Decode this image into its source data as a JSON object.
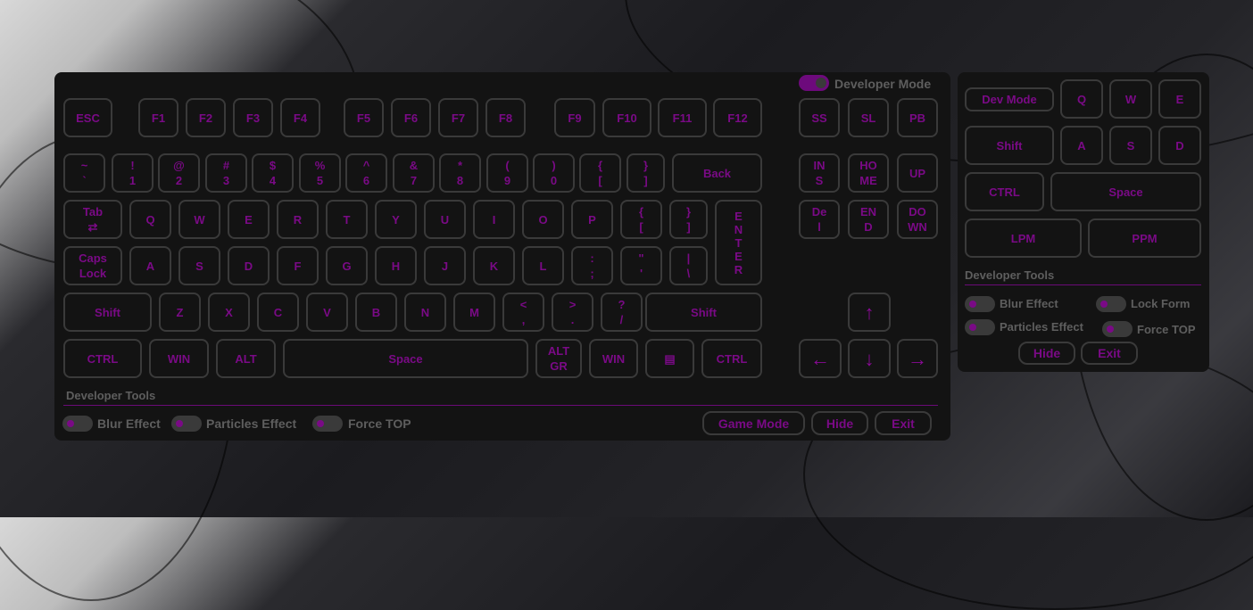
{
  "main": {
    "dev_mode_label": "Developer Mode",
    "keys": {
      "esc": "ESC",
      "f1": "F1",
      "f2": "F2",
      "f3": "F3",
      "f4": "F4",
      "f5": "F5",
      "f6": "F6",
      "f7": "F7",
      "f8": "F8",
      "f9": "F9",
      "f10": "F10",
      "f11": "F11",
      "f12": "F12",
      "ss": "SS",
      "sl": "SL",
      "pb": "PB",
      "tilde": "~\n`",
      "n1": "!\n1",
      "n2": "@\n2",
      "n3": "#\n3",
      "n4": "$\n4",
      "n5": "%\n5",
      "n6": "^\n6",
      "n7": "&\n7",
      "n8": "*\n8",
      "n9": "(\n9",
      "n0": ")\n0",
      "lbrace": "{\n[",
      "rbrace": "}\n]",
      "back": "Back",
      "ins": "IN\nS",
      "home": "HO\nME",
      "up_page": "UP",
      "tab": "Tab\n⇄",
      "q": "Q",
      "w": "W",
      "e": "E",
      "r": "R",
      "t": "T",
      "y": "Y",
      "u": "U",
      "i": "I",
      "o": "O",
      "p": "P",
      "lbrack": "{\n[",
      "rbrack": "}\n]",
      "enter": "E\nN\nT\nE\nR",
      "del": "De\nl",
      "end": "EN\nD",
      "down_page": "DO\nWN",
      "caps": "Caps\nLock",
      "a": "A",
      "s": "S",
      "d": "D",
      "f": "F",
      "g": "G",
      "h": "H",
      "j": "J",
      "k": "K",
      "l": "L",
      "semicolon": ":\n;",
      "quote": "\"\n'",
      "pipe": "|\n\\",
      "lshift": "Shift",
      "z": "Z",
      "x": "X",
      "c": "C",
      "v": "V",
      "b": "B",
      "n": "N",
      "m": "M",
      "comma": "<\n,",
      "period": ">\n.",
      "slash": "?\n/",
      "rshift": "Shift",
      "lctrl": "CTRL",
      "lwin": "WIN",
      "lalt": "ALT",
      "space": "Space",
      "altgr": "ALT\nGR",
      "rwin": "WIN",
      "menu": "▤",
      "rctrl": "CTRL",
      "arrow_up": "↑",
      "arrow_left": "←",
      "arrow_down": "↓",
      "arrow_right": "→"
    },
    "dev_tools_label": "Developer Tools",
    "toggles": {
      "blur": "Blur Effect",
      "particles": "Particles Effect",
      "force_top": "Force TOP"
    },
    "buttons": {
      "game_mode": "Game Mode",
      "hide": "Hide",
      "exit": "Exit"
    }
  },
  "side": {
    "keys": {
      "dev_mode": "Dev Mode",
      "q": "Q",
      "w": "W",
      "e": "E",
      "shift": "Shift",
      "a": "A",
      "s": "S",
      "d": "D",
      "ctrl": "CTRL",
      "space": "Space",
      "lpm": "LPM",
      "ppm": "PPM"
    },
    "dev_tools_label": "Developer Tools",
    "toggles": {
      "blur": "Blur Effect",
      "lock_form": "Lock Form",
      "particles": "Particles Effect",
      "force_top": "Force TOP"
    },
    "buttons": {
      "hide": "Hide",
      "exit": "Exit"
    }
  },
  "colors": {
    "accent": "#7a0a86",
    "panel": "#131313",
    "key_border": "#3a3a3a",
    "label": "#5e5e5e"
  }
}
